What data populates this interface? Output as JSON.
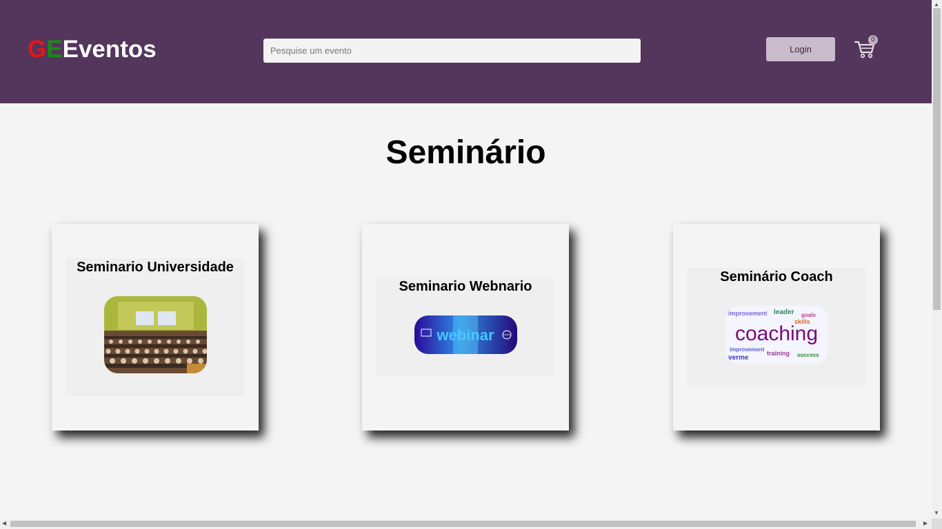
{
  "header": {
    "logo_g": "G",
    "logo_e": "E",
    "logo_rest": "Eventos",
    "search_placeholder": "Pesquise um evento",
    "login_label": "Login",
    "cart_count": "0"
  },
  "main": {
    "title": "Seminário",
    "cards": [
      {
        "title": "Seminario Universidade",
        "image": "lecture-hall-photo"
      },
      {
        "title": "Seminario Webnario",
        "image": "webinar-banner",
        "image_text": "webinar"
      },
      {
        "title": "Seminário Coach",
        "image": "coaching-word-cloud",
        "image_text": "coaching"
      }
    ]
  },
  "colors": {
    "header_bg": "#54355c",
    "logo_g": "#e8141a",
    "logo_e": "#1b8a1b",
    "login_bg": "#c8bccb",
    "page_bg": "#f4f4f4"
  },
  "icons": {
    "cart": "shopping-cart-icon"
  }
}
